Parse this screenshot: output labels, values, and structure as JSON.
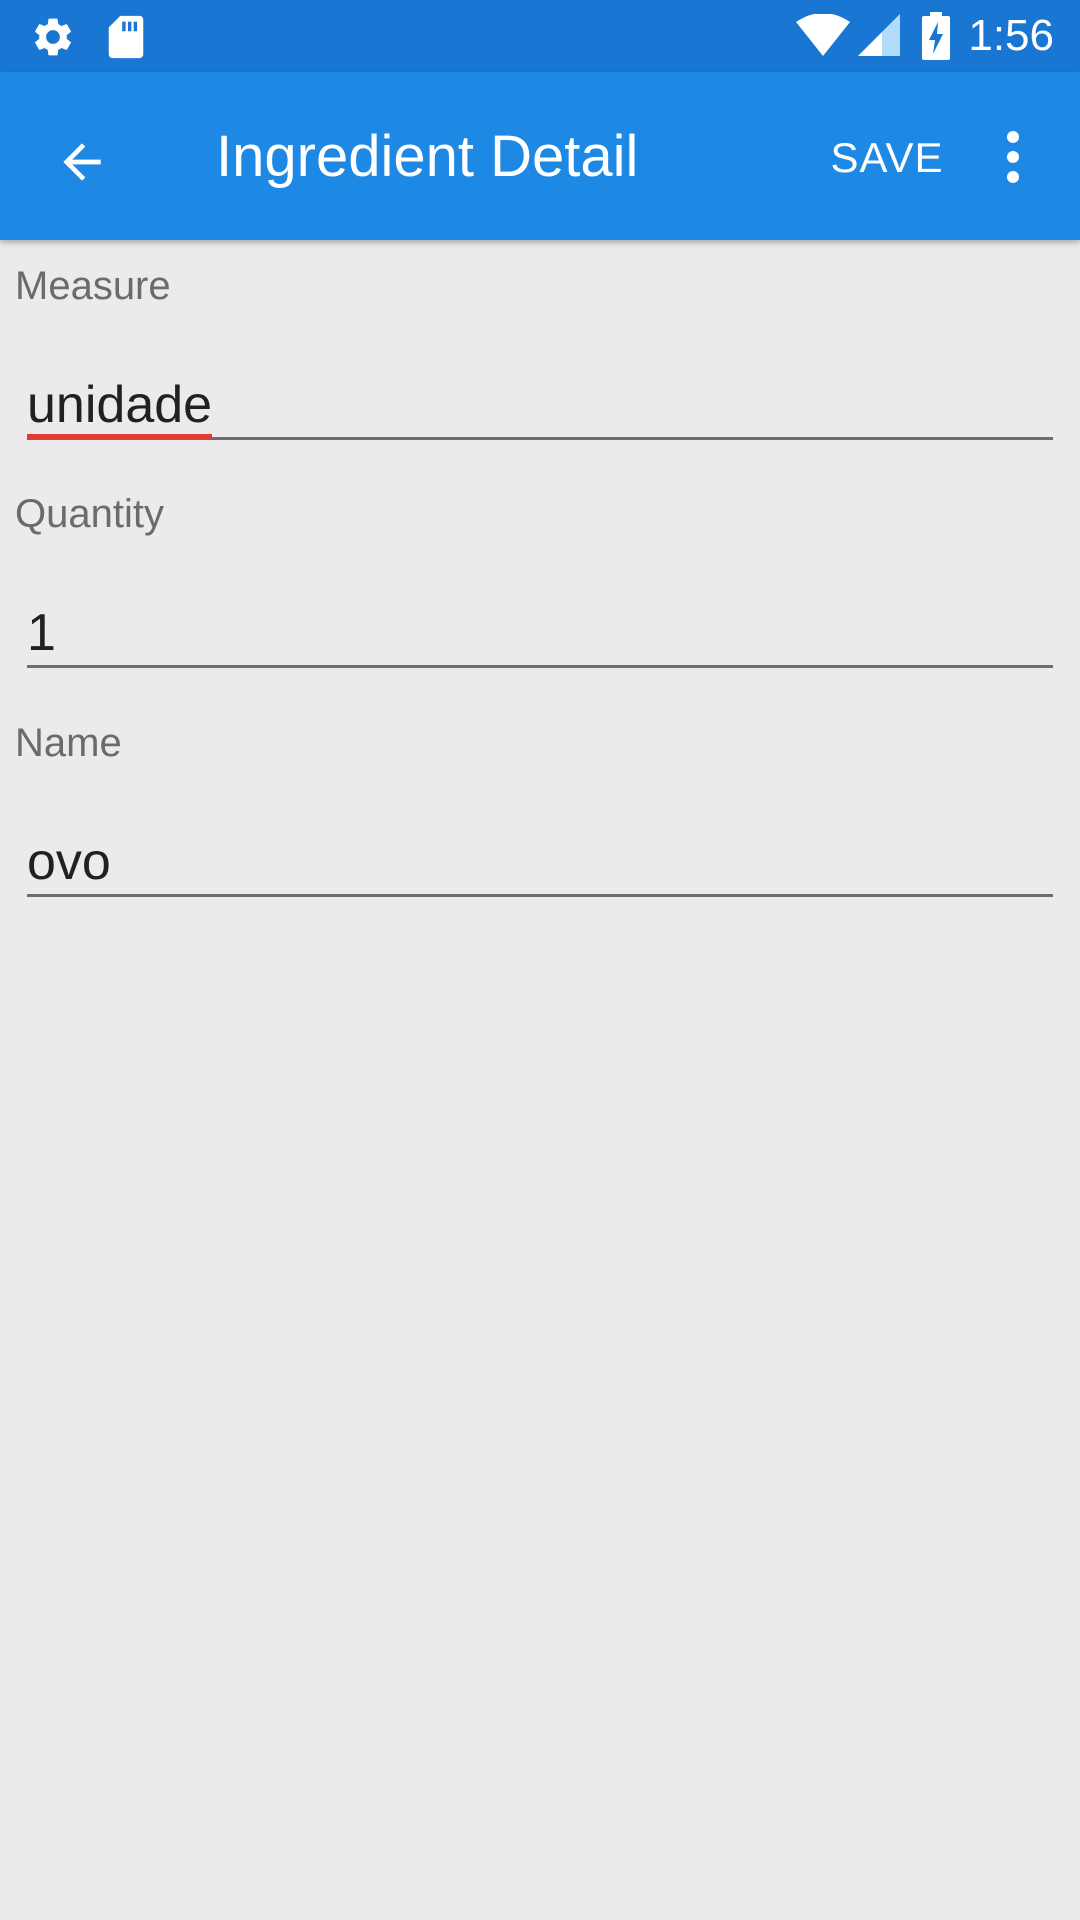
{
  "status_bar": {
    "time": "1:56",
    "icons": [
      "gear-icon",
      "sd-card-icon",
      "wifi-icon",
      "cell-signal-icon",
      "battery-charging-icon"
    ]
  },
  "app_bar": {
    "title": "Ingredient Detail",
    "save_label": "SAVE",
    "icons": [
      "back-arrow-icon",
      "overflow-menu-icon"
    ]
  },
  "form": {
    "measure_label": "Measure",
    "measure_value": "unidade",
    "quantity_label": "Quantity",
    "quantity_value": "1",
    "name_label": "Name",
    "name_value": "ovo"
  },
  "colors": {
    "status_bar": "#1976d2",
    "app_bar": "#1e88e5",
    "background": "#ebebeb",
    "spellcheck": "#e53935"
  }
}
